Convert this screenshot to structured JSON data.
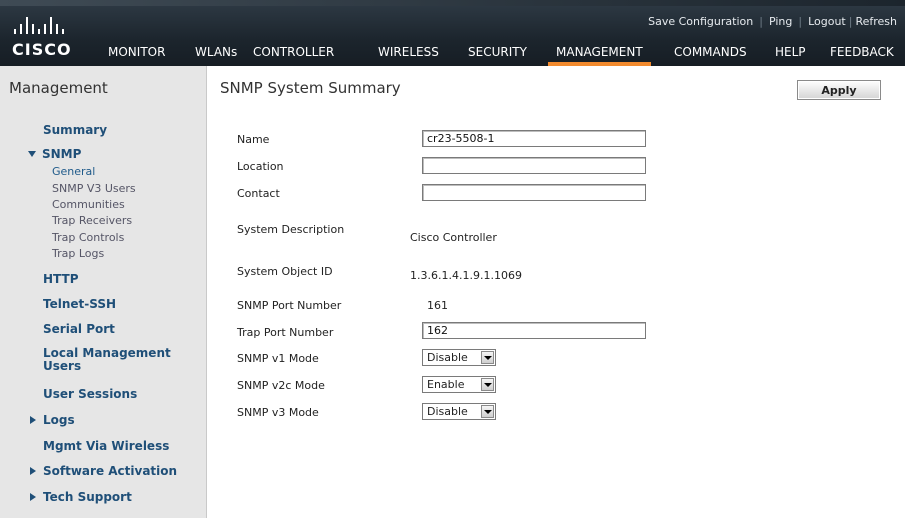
{
  "header": {
    "brand": "CISCO",
    "utility_links": [
      "Save Configuration",
      "Ping",
      "Logout",
      "Refresh"
    ],
    "nav": [
      "MONITOR",
      "WLANs",
      "CONTROLLER",
      "WIRELESS",
      "SECURITY",
      "MANAGEMENT",
      "COMMANDS",
      "HELP",
      "FEEDBACK"
    ],
    "active_nav": "MANAGEMENT",
    "accent_color": "#f28a2e"
  },
  "sidebar": {
    "title": "Management",
    "items": {
      "summary": "Summary",
      "snmp": "SNMP",
      "snmp_sub": [
        "General",
        "SNMP V3 Users",
        "Communities",
        "Trap Receivers",
        "Trap Controls",
        "Trap Logs"
      ],
      "http": "HTTP",
      "telnet": "Telnet-SSH",
      "serial": "Serial Port",
      "local_mgmt": "Local Management Users",
      "user_sessions": "User Sessions",
      "logs": "Logs",
      "mgmt_wireless": "Mgmt Via Wireless",
      "software_activation": "Software Activation",
      "tech_support": "Tech Support"
    }
  },
  "main": {
    "title": "SNMP System Summary",
    "apply_label": "Apply",
    "fields": {
      "name": {
        "label": "Name",
        "value": "cr23-5508-1"
      },
      "location": {
        "label": "Location",
        "value": ""
      },
      "contact": {
        "label": "Contact",
        "value": ""
      },
      "description": {
        "label": "System Description",
        "value": "Cisco Controller"
      },
      "object_id": {
        "label": "System Object ID",
        "value": "1.3.6.1.4.1.9.1.1069"
      },
      "snmp_port": {
        "label": "SNMP Port Number",
        "value": "161"
      },
      "trap_port": {
        "label": "Trap Port Number",
        "value": "162"
      },
      "v1_mode": {
        "label": "SNMP v1 Mode",
        "value": "Disable"
      },
      "v2c_mode": {
        "label": "SNMP v2c Mode",
        "value": "Enable"
      },
      "v3_mode": {
        "label": "SNMP v3 Mode",
        "value": "Disable"
      }
    }
  }
}
